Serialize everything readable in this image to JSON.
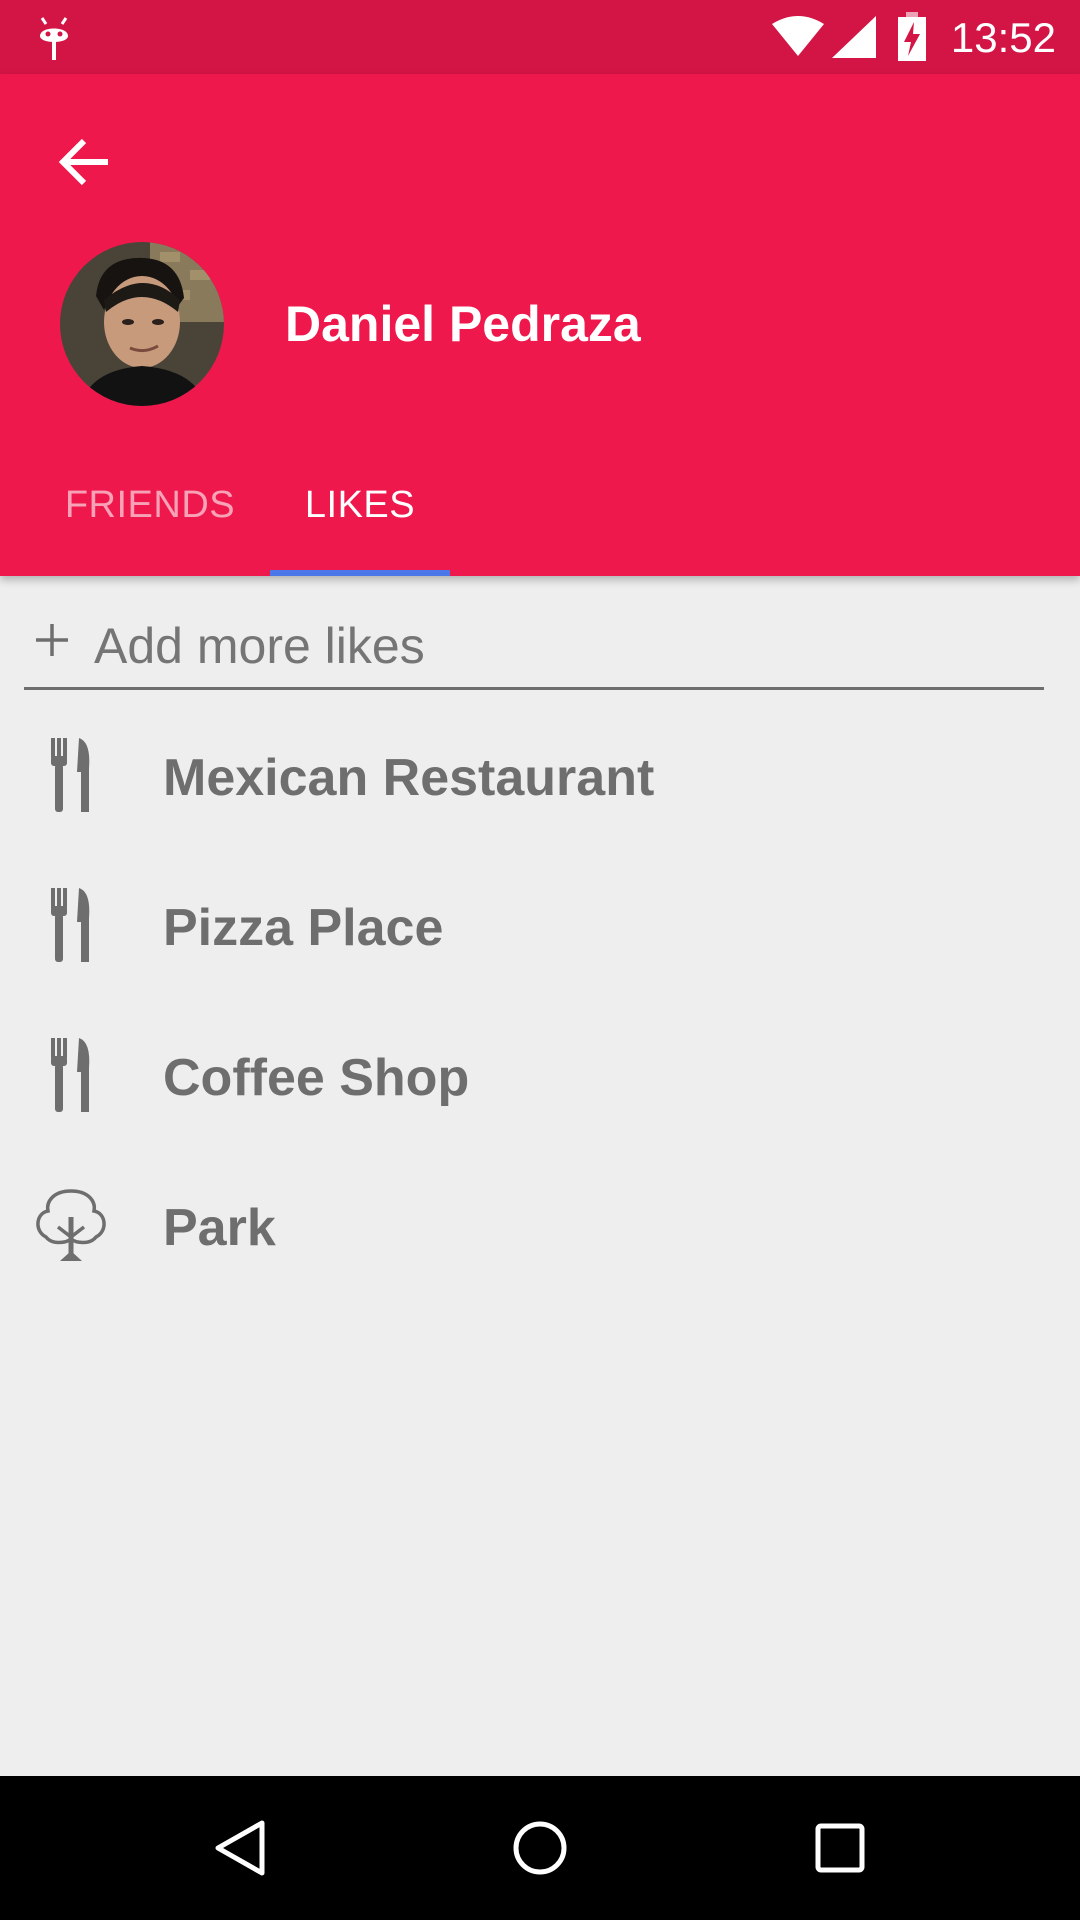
{
  "status_bar": {
    "time": "13:52",
    "icons": [
      "debug-icon",
      "wifi-icon",
      "signal-icon",
      "battery-charging-icon"
    ]
  },
  "app_bar": {
    "back_icon": "arrow-back-icon",
    "profile_name": "Daniel Pedraza",
    "avatar": "profile-photo"
  },
  "tabs": [
    {
      "label": "FRIENDS",
      "selected": false
    },
    {
      "label": "LIKES",
      "selected": true
    }
  ],
  "add_field": {
    "icon": "plus-icon",
    "placeholder": "Add more likes",
    "value": ""
  },
  "likes": [
    {
      "label": "Mexican Restaurant",
      "icon": "restaurant-icon"
    },
    {
      "label": "Pizza Place",
      "icon": "restaurant-icon"
    },
    {
      "label": "Coffee Shop",
      "icon": "restaurant-icon"
    },
    {
      "label": "Park",
      "icon": "park-tree-icon"
    }
  ],
  "nav_bar": {
    "icons": [
      "nav-back-icon",
      "nav-home-icon",
      "nav-recents-icon"
    ]
  },
  "colors": {
    "status_bar": "#d31545",
    "primary": "#ee184c",
    "tab_indicator": "#4b77e8",
    "background": "#eeeeee",
    "list_text": "#6e6e6e"
  }
}
